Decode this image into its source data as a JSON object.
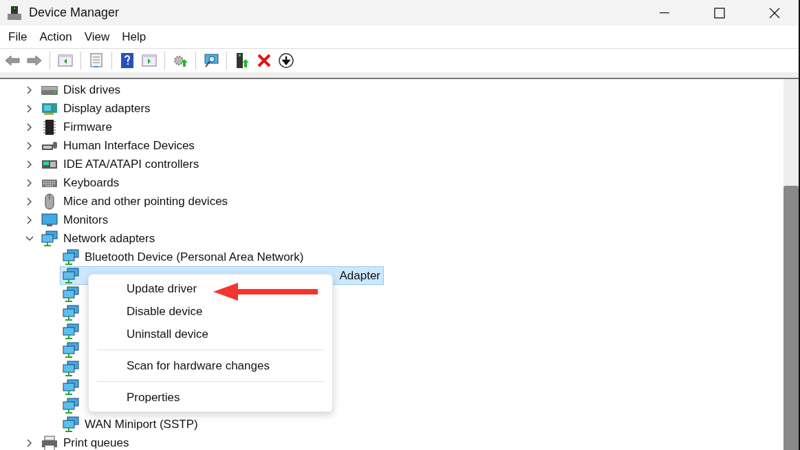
{
  "window": {
    "title": "Device Manager"
  },
  "menu_bar": [
    "File",
    "Action",
    "View",
    "Help"
  ],
  "toolbar": [
    {
      "kind": "back"
    },
    {
      "kind": "forward"
    },
    {
      "kind": "sep"
    },
    {
      "kind": "panel-left"
    },
    {
      "kind": "sep"
    },
    {
      "kind": "sheet"
    },
    {
      "kind": "sep"
    },
    {
      "kind": "help"
    },
    {
      "kind": "panel-right"
    },
    {
      "kind": "sep"
    },
    {
      "kind": "gear-up"
    },
    {
      "kind": "sep"
    },
    {
      "kind": "monitor-search"
    },
    {
      "kind": "sep"
    },
    {
      "kind": "device-up"
    },
    {
      "kind": "remove"
    },
    {
      "kind": "down"
    }
  ],
  "tree": [
    {
      "label": "Disk drives",
      "kind": "disk",
      "expanded": false
    },
    {
      "label": "Display adapters",
      "kind": "display",
      "expanded": false
    },
    {
      "label": "Firmware",
      "kind": "chip",
      "expanded": false
    },
    {
      "label": "Human Interface Devices",
      "kind": "hid",
      "expanded": false
    },
    {
      "label": "IDE ATA/ATAPI controllers",
      "kind": "ide",
      "expanded": false
    },
    {
      "label": "Keyboards",
      "kind": "keyboard",
      "expanded": false
    },
    {
      "label": "Mice and other pointing devices",
      "kind": "mouse",
      "expanded": false
    },
    {
      "label": "Monitors",
      "kind": "monitor",
      "expanded": false
    },
    {
      "label": "Network adapters",
      "kind": "network",
      "expanded": true,
      "children": [
        {
          "label": "Bluetooth Device (Personal Area Network)",
          "selected": false
        },
        {
          "label_end": "Adapter",
          "selected": true
        },
        {
          "selected": false
        },
        {
          "selected": false
        },
        {
          "selected": false
        },
        {
          "selected": false
        },
        {
          "selected": false
        },
        {
          "selected": false
        },
        {
          "selected": false
        },
        {
          "label": "WAN Miniport (SSTP)",
          "selected": false
        }
      ]
    },
    {
      "label": "Print queues",
      "kind": "printer",
      "expanded": false
    }
  ],
  "context_menu": [
    {
      "kind": "item",
      "label": "Update driver"
    },
    {
      "kind": "item",
      "label": "Disable device"
    },
    {
      "kind": "item",
      "label": "Uninstall device"
    },
    {
      "kind": "separator"
    },
    {
      "kind": "item",
      "label": "Scan for hardware changes"
    },
    {
      "kind": "separator"
    },
    {
      "kind": "item",
      "label": "Properties"
    }
  ]
}
